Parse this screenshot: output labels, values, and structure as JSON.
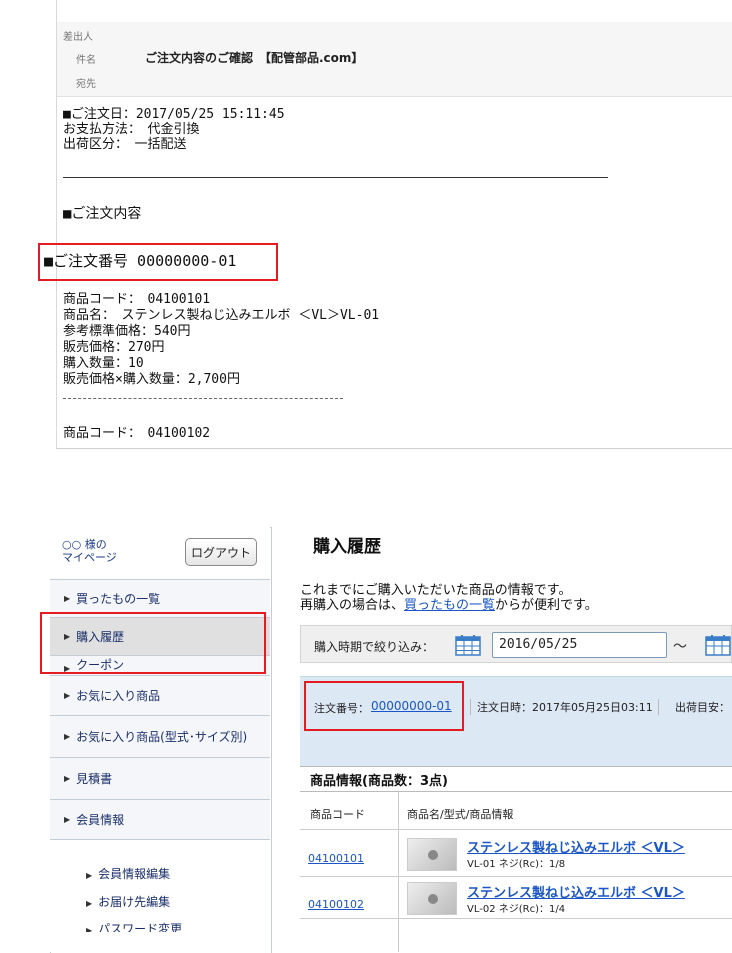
{
  "email": {
    "from_label": "差出人",
    "subject_label": "件名",
    "to_label": "宛先",
    "subject": "ご注文内容のご確認　【配管部品.com】",
    "order_date_line": "■ご注文日：2017/05/25 15:11:45",
    "payment_line": "お支払方法：　代金引換",
    "shipping_line": "出荷区分：　一括配送",
    "order_contents_heading": "■ご注文内容",
    "order_number_line": "■ご注文番号 00000000-01",
    "item1": {
      "code_line": "商品コード：　04100101",
      "name_line": "商品名：　ステンレス製ねじ込みエルボ ＜VL＞VL-01",
      "list_price_line": "参考標準価格：540円",
      "price_line": "販売価格：270円",
      "qty_line": "購入数量：10",
      "subtotal_line": "販売価格×購入数量：2,700円"
    },
    "item2_code_line": "商品コード：　04100102"
  },
  "sidebar": {
    "user_name": "○○ 様の",
    "user_page": "マイページ",
    "logout": "ログアウト",
    "items": [
      {
        "label": "買ったもの一覧"
      },
      {
        "label": "購入履歴"
      },
      {
        "label": "クーポン"
      },
      {
        "label": "お気に入り商品"
      },
      {
        "label": "お気に入り商品(型式･サイズ別)"
      },
      {
        "label": "見積書"
      },
      {
        "label": "会員情報"
      }
    ],
    "sub_items": [
      {
        "label": "会員情報編集"
      },
      {
        "label": "お届け先編集"
      },
      {
        "label": "パスワード変更"
      }
    ]
  },
  "main": {
    "title": "購入履歴",
    "intro_line1": "これまでにご購入いただいた商品の情報です。",
    "intro_line2_pre": "再購入の場合は、",
    "intro_link": "買ったもの一覧",
    "intro_line2_post": "からが便利です。",
    "filter_label": "購入時期で絞り込み：",
    "filter_from": "2016/05/25",
    "filter_tilde": "～",
    "order_no_label": "注文番号：",
    "order_no": "00000000-01",
    "order_datetime": "注文日時：2017年05月25日03:11",
    "ship_est": "出荷目安：",
    "items_title": "商品情報(商品数：3点)",
    "col_code": "商品コード",
    "col_name": "商品名/型式/商品情報",
    "rows": [
      {
        "code": "04100101",
        "name": "ステンレス製ねじ込みエルボ ＜VL＞",
        "spec": "VL-01 ネジ(Rc)：1/8"
      },
      {
        "code": "04100102",
        "name": "ステンレス製ねじ込みエルボ ＜VL＞",
        "spec": "VL-02 ネジ(Rc)：1/4"
      }
    ]
  }
}
